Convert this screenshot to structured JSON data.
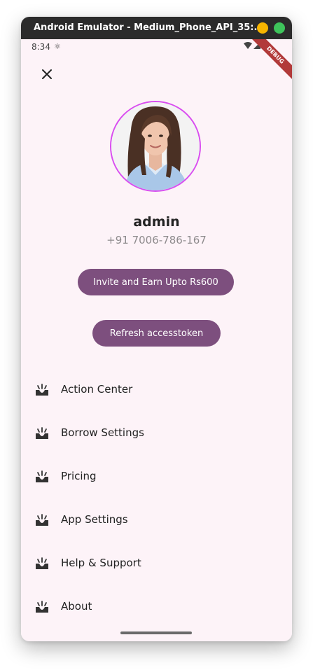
{
  "window": {
    "title": "Android Emulator - Medium_Phone_API_35:...",
    "minimize_color": "#f7b500",
    "maximize_color": "#3ec45b"
  },
  "status_bar": {
    "time": "8:34"
  },
  "debug_banner": "DEBUG",
  "profile": {
    "name": "admin",
    "phone": "+91 7006-786-167"
  },
  "buttons": {
    "invite": "Invite and Earn Upto Rs600",
    "refresh": "Refresh accesstoken"
  },
  "menu": [
    {
      "label": "Action Center",
      "icon": "inbox-icon"
    },
    {
      "label": "Borrow Settings",
      "icon": "inbox-icon"
    },
    {
      "label": "Pricing",
      "icon": "inbox-icon"
    },
    {
      "label": "App Settings",
      "icon": "inbox-icon"
    },
    {
      "label": "Help & Support",
      "icon": "inbox-icon"
    },
    {
      "label": "About",
      "icon": "inbox-icon"
    }
  ],
  "colors": {
    "accent_button": "#7d4f7e",
    "screen_background": "#fdf3f8",
    "avatar_border": "#d94df0"
  }
}
